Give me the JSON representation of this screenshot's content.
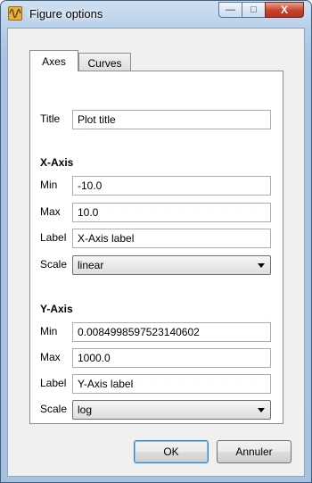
{
  "window": {
    "title": "Figure options",
    "icon": "matplotlib-wave-icon"
  },
  "caption_buttons": {
    "minimize": "—",
    "maximize": "□",
    "close": "X"
  },
  "tabs": [
    {
      "label": "Axes",
      "selected": true
    },
    {
      "label": "Curves",
      "selected": false
    }
  ],
  "axes": {
    "title_label": "Title",
    "title_value": "Plot title",
    "x_axis": {
      "heading": "X-Axis",
      "min_label": "Min",
      "min_value": "-10.0",
      "max_label": "Max",
      "max_value": "10.0",
      "label_label": "Label",
      "label_value": "X-Axis label",
      "scale_label": "Scale",
      "scale_value": "linear"
    },
    "y_axis": {
      "heading": "Y-Axis",
      "min_label": "Min",
      "min_value": "0.0084998597523140602",
      "max_label": "Max",
      "max_value": "1000.0",
      "label_label": "Label",
      "label_value": "Y-Axis label",
      "scale_label": "Scale",
      "scale_value": "log"
    }
  },
  "buttons": {
    "ok": "OK",
    "cancel": "Annuler"
  }
}
